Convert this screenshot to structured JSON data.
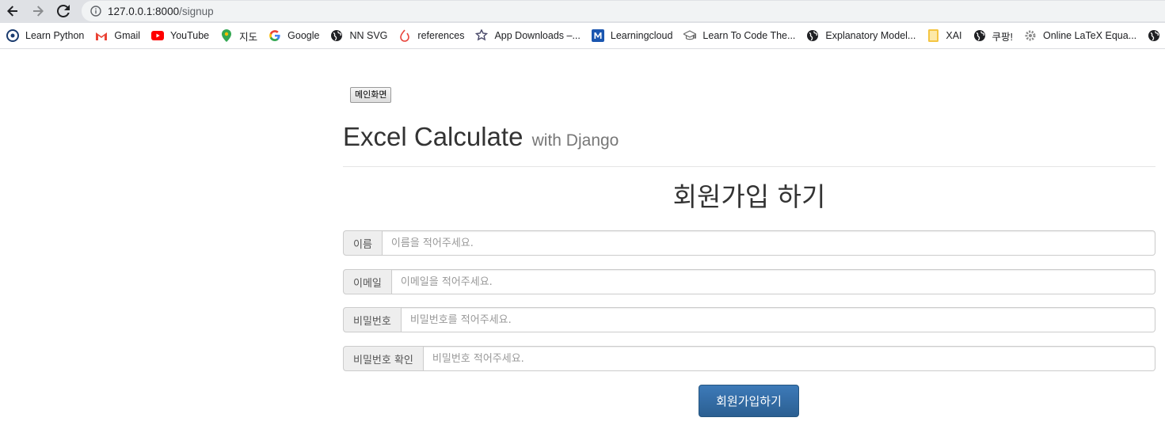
{
  "browser": {
    "url_host": "127.0.0.1:8000",
    "url_path": "/signup",
    "back_icon": "arrow-left-icon",
    "forward_icon": "arrow-right-icon",
    "reload_icon": "reload-icon",
    "info_icon": "info-icon"
  },
  "bookmarks": [
    {
      "label": "Learn Python",
      "icon": "python-icon",
      "color": "#1a3b6e"
    },
    {
      "label": "Gmail",
      "icon": "gmail-icon",
      "color": "#ea4335"
    },
    {
      "label": "YouTube",
      "icon": "youtube-icon",
      "color": "#ff0000"
    },
    {
      "label": "지도",
      "icon": "maps-pin-icon",
      "color": "#34a853"
    },
    {
      "label": "Google",
      "icon": "google-icon",
      "color": "#4285f4"
    },
    {
      "label": "NN SVG",
      "icon": "globe-icon",
      "color": "#202124"
    },
    {
      "label": "references",
      "icon": "refworks-icon",
      "color": "#e8453c"
    },
    {
      "label": "App Downloads –...",
      "icon": "flower-icon",
      "color": "#4a4a6a"
    },
    {
      "label": "Learningcloud",
      "icon": "learningcloud-icon",
      "color": "#1a56b0"
    },
    {
      "label": "Learn To Code The...",
      "icon": "graduation-cap-icon",
      "color": "#666666"
    },
    {
      "label": "Explanatory Model...",
      "icon": "globe-icon",
      "color": "#202124"
    },
    {
      "label": "XAI",
      "icon": "folder-icon",
      "color": "#f4c542"
    },
    {
      "label": "쿠팡!",
      "icon": "globe-icon",
      "color": "#202124"
    },
    {
      "label": "Online LaTeX Equa...",
      "icon": "gear-icon",
      "color": "#888888"
    }
  ],
  "page": {
    "main_button": "메인화면",
    "title": "Excel Calculate",
    "subtitle": "with Django",
    "heading": "회원가입 하기",
    "fields": [
      {
        "label": "이름",
        "placeholder": "이름을 적어주세요.",
        "value": ""
      },
      {
        "label": "이메일",
        "placeholder": "이메일을 적어주세요.",
        "value": ""
      },
      {
        "label": "비밀번호",
        "placeholder": "비밀번호를 적어주세요.",
        "value": ""
      },
      {
        "label": "비밀번호 확인",
        "placeholder": "비밀번호 적어주세요.",
        "value": ""
      }
    ],
    "submit": "회원가입하기"
  },
  "colors": {
    "primary_button": "#2b6aa6",
    "toolbar": "#dfe1e5",
    "addon_bg": "#eeeeee"
  }
}
